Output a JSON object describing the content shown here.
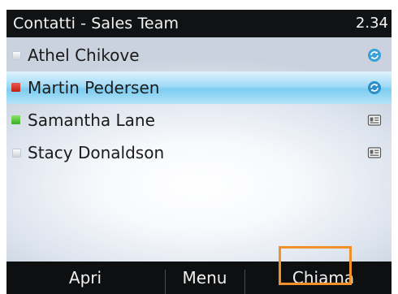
{
  "header": {
    "title": "Contatti - Sales Team",
    "time": "2.34"
  },
  "contacts": [
    {
      "name": "Athel Chikove",
      "status": "offline",
      "icon": "sync-icon",
      "selected": false
    },
    {
      "name": "Martin Pedersen",
      "status": "busy",
      "icon": "sync-icon",
      "selected": true
    },
    {
      "name": "Samantha Lane",
      "status": "available",
      "icon": "contact-card-icon",
      "selected": false
    },
    {
      "name": "Stacy Donaldson",
      "status": "offline",
      "icon": "contact-card-icon",
      "selected": false
    }
  ],
  "softkeys": {
    "left": "Apri",
    "middle": "Menu",
    "right": "Chiama"
  },
  "colors": {
    "titlebar": "#101214",
    "selection": "#7ccdf1",
    "busy": "#c21e12",
    "available": "#35b024",
    "sync_icon": "#3aa0d8",
    "highlight_box": "#f2902c"
  }
}
